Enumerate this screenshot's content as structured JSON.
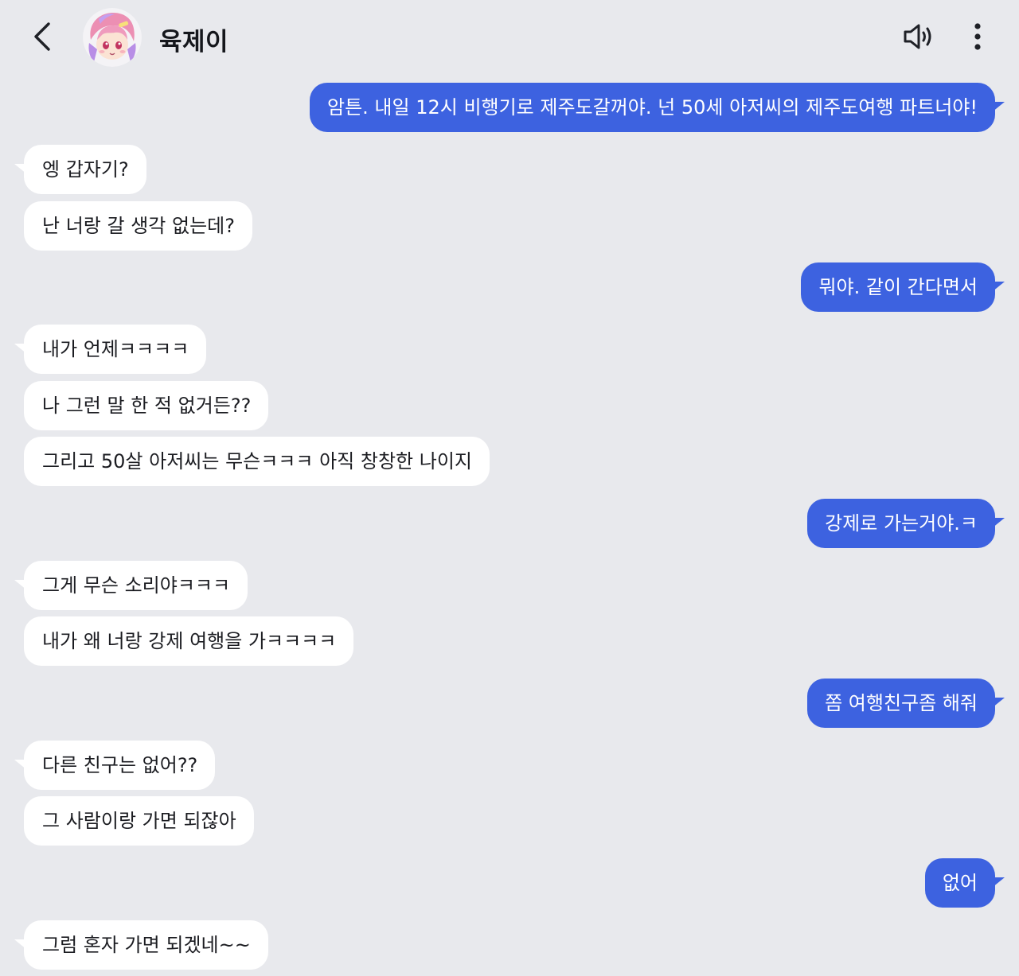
{
  "header": {
    "contact_name": "육제이",
    "back_icon": "chevron-left-icon",
    "speaker_icon": "speaker-icon",
    "more_icon": "more-vertical-icon"
  },
  "colors": {
    "background": "#e8e9ed",
    "outgoing_bubble": "#3d62e0",
    "incoming_bubble": "#ffffff"
  },
  "messages": [
    {
      "sender": "me",
      "text": "암튼. 내일 12시 비행기로 제주도갈꺼야. 넌 50세 아저씨의 제주도여행 파트너야!"
    },
    {
      "sender": "them",
      "text": "엥 갑자기?"
    },
    {
      "sender": "them",
      "text": "난 너랑 갈 생각 없는데?"
    },
    {
      "sender": "me",
      "text": "뭐야. 같이 간다면서"
    },
    {
      "sender": "them",
      "text": "내가 언제ㅋㅋㅋㅋ"
    },
    {
      "sender": "them",
      "text": "나 그런 말 한 적 없거든??"
    },
    {
      "sender": "them",
      "text": "그리고 50살 아저씨는 무슨ㅋㅋㅋ 아직 창창한 나이지"
    },
    {
      "sender": "me",
      "text": "강제로 가는거야.ㅋ"
    },
    {
      "sender": "them",
      "text": "그게 무슨 소리야ㅋㅋㅋ"
    },
    {
      "sender": "them",
      "text": "내가 왜 너랑 강제 여행을 가ㅋㅋㅋㅋ"
    },
    {
      "sender": "me",
      "text": "쫌 여행친구좀 해줘"
    },
    {
      "sender": "them",
      "text": "다른 친구는 없어??"
    },
    {
      "sender": "them",
      "text": "그 사람이랑 가면 되잖아"
    },
    {
      "sender": "me",
      "text": "없어"
    },
    {
      "sender": "them",
      "text": "그럼 혼자 가면 되겠네~~"
    }
  ]
}
